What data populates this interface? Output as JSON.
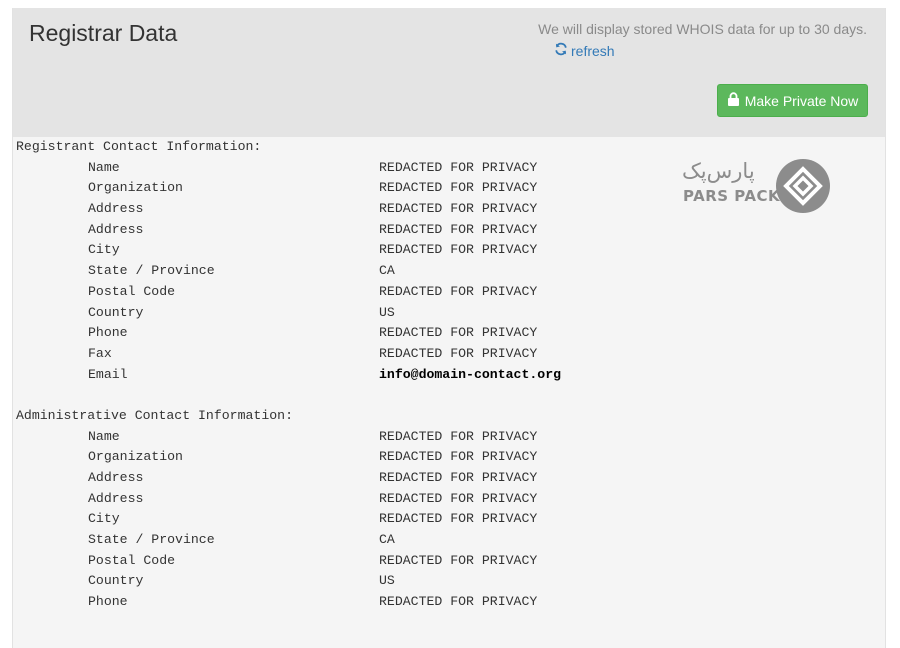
{
  "header": {
    "title": "Registrar Data",
    "notice": "We will display stored WHOIS data for up to 30 days.",
    "refresh_label": "refresh",
    "make_private_label": "Make Private Now"
  },
  "logo": {
    "text_fa": "پارس‌پک",
    "text_en": "PARS PACK"
  },
  "registrant": {
    "heading": "Registrant Contact Information:",
    "rows": [
      {
        "label": "Name",
        "value": "REDACTED FOR PRIVACY"
      },
      {
        "label": "Organization",
        "value": "REDACTED FOR PRIVACY"
      },
      {
        "label": "Address",
        "value": "REDACTED FOR PRIVACY"
      },
      {
        "label": "Address",
        "value": "REDACTED FOR PRIVACY"
      },
      {
        "label": "City",
        "value": "REDACTED FOR PRIVACY"
      },
      {
        "label": "State / Province",
        "value": "CA"
      },
      {
        "label": "Postal Code",
        "value": "REDACTED FOR PRIVACY"
      },
      {
        "label": "Country",
        "value": "US"
      },
      {
        "label": "Phone",
        "value": "REDACTED FOR PRIVACY"
      },
      {
        "label": "Fax",
        "value": "REDACTED FOR PRIVACY"
      },
      {
        "label": "Email",
        "value": "info@domain-contact.org"
      }
    ]
  },
  "administrative": {
    "heading": "Administrative Contact Information:",
    "rows": [
      {
        "label": "Name",
        "value": "REDACTED FOR PRIVACY"
      },
      {
        "label": "Organization",
        "value": "REDACTED FOR PRIVACY"
      },
      {
        "label": "Address",
        "value": "REDACTED FOR PRIVACY"
      },
      {
        "label": "Address",
        "value": "REDACTED FOR PRIVACY"
      },
      {
        "label": "City",
        "value": "REDACTED FOR PRIVACY"
      },
      {
        "label": "State / Province",
        "value": "CA"
      },
      {
        "label": "Postal Code",
        "value": "REDACTED FOR PRIVACY"
      },
      {
        "label": "Country",
        "value": "US"
      },
      {
        "label": "Phone",
        "value": "REDACTED FOR PRIVACY"
      }
    ]
  },
  "colors": {
    "accent_link": "#337ab7",
    "button_green": "#5cb85c",
    "header_bg": "#e4e4e4"
  },
  "icons": {
    "refresh": "refresh-icon",
    "lock": "lock-icon",
    "logo_mark": "pars-pack-logo-icon"
  }
}
